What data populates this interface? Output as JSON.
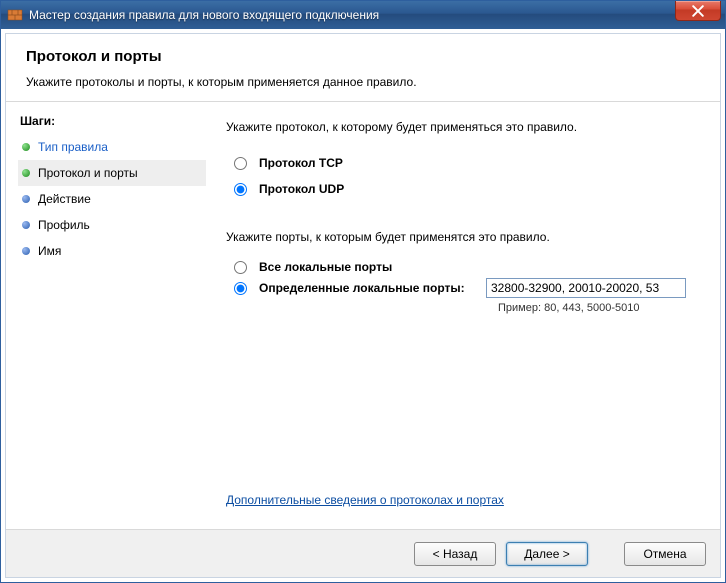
{
  "titlebar": {
    "title": "Мастер создания правила для нового входящего подключения"
  },
  "header": {
    "title": "Протокол и порты",
    "subtitle": "Укажите протоколы и порты, к которым применяется данное правило."
  },
  "sidebar": {
    "heading": "Шаги:",
    "items": [
      {
        "label": "Тип правила",
        "state": "completed"
      },
      {
        "label": "Протокол и порты",
        "state": "current"
      },
      {
        "label": "Действие",
        "state": "pending"
      },
      {
        "label": "Профиль",
        "state": "pending"
      },
      {
        "label": "Имя",
        "state": "pending"
      }
    ]
  },
  "main": {
    "protocol_prompt": "Укажите протокол, к которому будет применяться это правило.",
    "protocol_options": {
      "tcp": "Протокол TCP",
      "udp": "Протокол UDP"
    },
    "ports_prompt": "Укажите порты, к которым будет применятся это правило.",
    "ports_options": {
      "all": "Все локальные порты",
      "specific": "Определенные локальные порты:"
    },
    "ports_value": "32800-32900, 20010-20020, 53",
    "example_label": "Пример: 80, 443, 5000-5010",
    "help_link": "Дополнительные сведения о протоколах и портах"
  },
  "footer": {
    "back": "< Назад",
    "next": "Далее >",
    "cancel": "Отмена"
  }
}
